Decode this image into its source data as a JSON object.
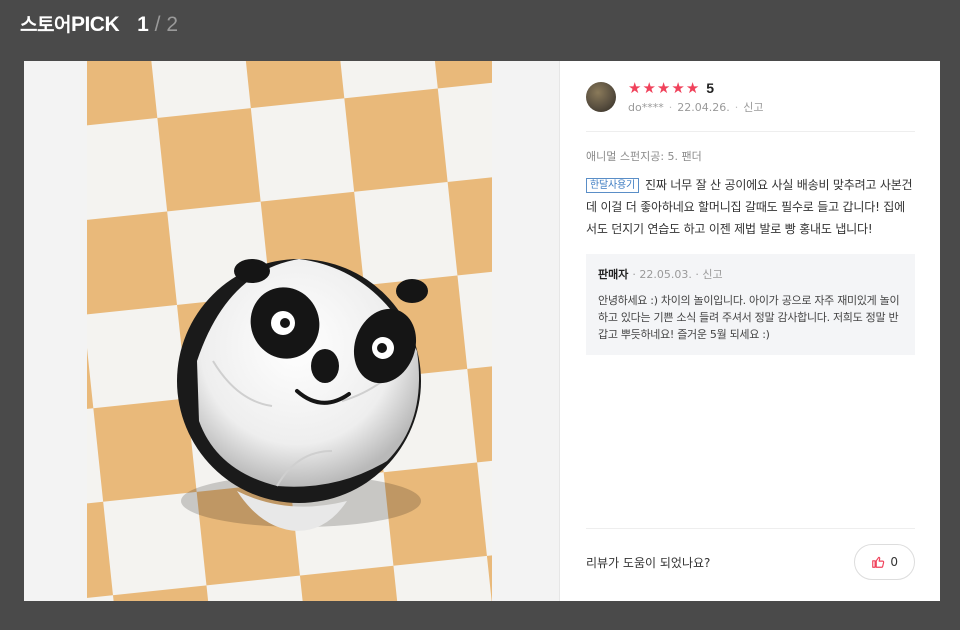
{
  "header": {
    "brand_prefix": "스토어",
    "brand_pick": "PICK",
    "page_current": "1",
    "page_separator": "/",
    "page_total": "2"
  },
  "review": {
    "rating_value": 5,
    "rating_label": "5",
    "author": "do****",
    "date": "22.04.26.",
    "report_label": "신고",
    "option": "애니멀 스펀지공: 5. 팬더",
    "badge": "한달사용기",
    "text": "진짜 너무 잘 산 공이에요 사실 배송비 맞추려고 사본건데 이걸 더 좋아하네요 할머니집 갈때도 필수로 들고 갑니다! 집에서도 던지기 연습도 하고 이젠 제법 발로 빵 홍내도 냅니다!"
  },
  "seller_reply": {
    "name": "판매자",
    "date": "22.05.03.",
    "report_label": "신고",
    "text": "안녕하세요 :) 차이의 놀이입니다. 아이가 공으로 자주 재미있게 놀이하고 있다는 기쁜 소식 들려 주셔서 정말 감사합니다. 저희도 정말 반갑고 뿌듯하네요! 즐거운 5월 되세요 :)"
  },
  "helpful": {
    "question": "리뷰가 도움이 되었나요?",
    "like_count": "0"
  },
  "colors": {
    "star": "#f0425b",
    "badge": "#3d7cc2",
    "overlay": "#4a4a4a"
  },
  "icons": {
    "star": "star-icon",
    "like": "thumbs-up-icon"
  }
}
